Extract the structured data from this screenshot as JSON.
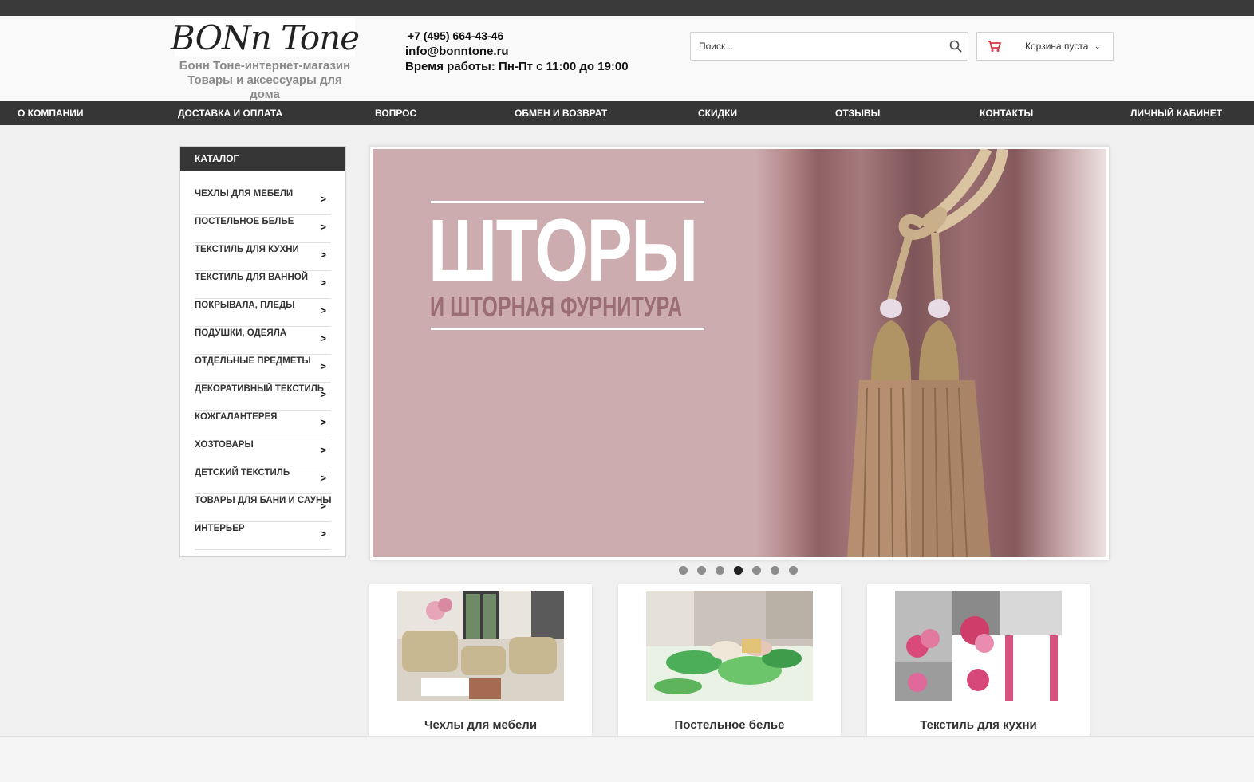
{
  "colors": {
    "dark": "#363636",
    "accent_red": "#d9333f",
    "banner_bg": "#cdacaf",
    "banner_sub": "#9a6e73"
  },
  "header": {
    "logo_text": "BONn Tone",
    "logo_sub": "Бонн Тоне-интернет-магазин Товары и аксессуары для дома",
    "phone": "+7 (495) 664-43-46",
    "email": "info@bonntone.ru",
    "hours": "Время работы: Пн-Пт с 11:00 до 19:00",
    "search_placeholder": "Поиск...",
    "search_icon": "magnifier",
    "cart_icon": "shopping-cart",
    "cart_label": "Корзина пуста"
  },
  "nav": {
    "items": [
      {
        "label": "О КОМПАНИИ"
      },
      {
        "label": "ДОСТАВКА И ОПЛАТА"
      },
      {
        "label": "ВОПРОС"
      },
      {
        "label": "ОБМЕН И ВОЗВРАТ"
      },
      {
        "label": "СКИДКИ"
      },
      {
        "label": "ОТЗЫВЫ"
      },
      {
        "label": "КОНТАКТЫ"
      },
      {
        "label": "ЛИЧНЫЙ КАБИНЕТ"
      }
    ]
  },
  "catalog": {
    "title": "КАТАЛОГ",
    "arrow": ">",
    "items": [
      {
        "label": "ЧЕХЛЫ ДЛЯ МЕБЕЛИ"
      },
      {
        "label": "ПОСТЕЛЬНОЕ БЕЛЬЕ"
      },
      {
        "label": "ТЕКСТИЛЬ ДЛЯ КУХНИ"
      },
      {
        "label": "ТЕКСТИЛЬ ДЛЯ ВАННОЙ"
      },
      {
        "label": "ПОКРЫВАЛА, ПЛЕДЫ"
      },
      {
        "label": "ПОДУШКИ, ОДЕЯЛА"
      },
      {
        "label": "ОТДЕЛЬНЫЕ ПРЕДМЕТЫ"
      },
      {
        "label": "ДЕКОРАТИВНЫЙ ТЕКСТИЛЬ"
      },
      {
        "label": "КОЖГАЛАНТЕРЕЯ"
      },
      {
        "label": "ХОЗТОВАРЫ"
      },
      {
        "label": "ДЕТСКИЙ ТЕКСТИЛЬ"
      },
      {
        "label": "ТОВАРЫ ДЛЯ БАНИ И САУНЫ"
      },
      {
        "label": "ИНТЕРЬЕР"
      }
    ]
  },
  "slider": {
    "title": "ШТОРЫ",
    "subtitle": "И ШТОРНАЯ ФУРНИТУРА",
    "slide_count": 7,
    "active_index": 3
  },
  "cards": [
    {
      "title": "Чехлы для мебели"
    },
    {
      "title": "Постельное белье"
    },
    {
      "title": "Текстиль для кухни"
    }
  ]
}
